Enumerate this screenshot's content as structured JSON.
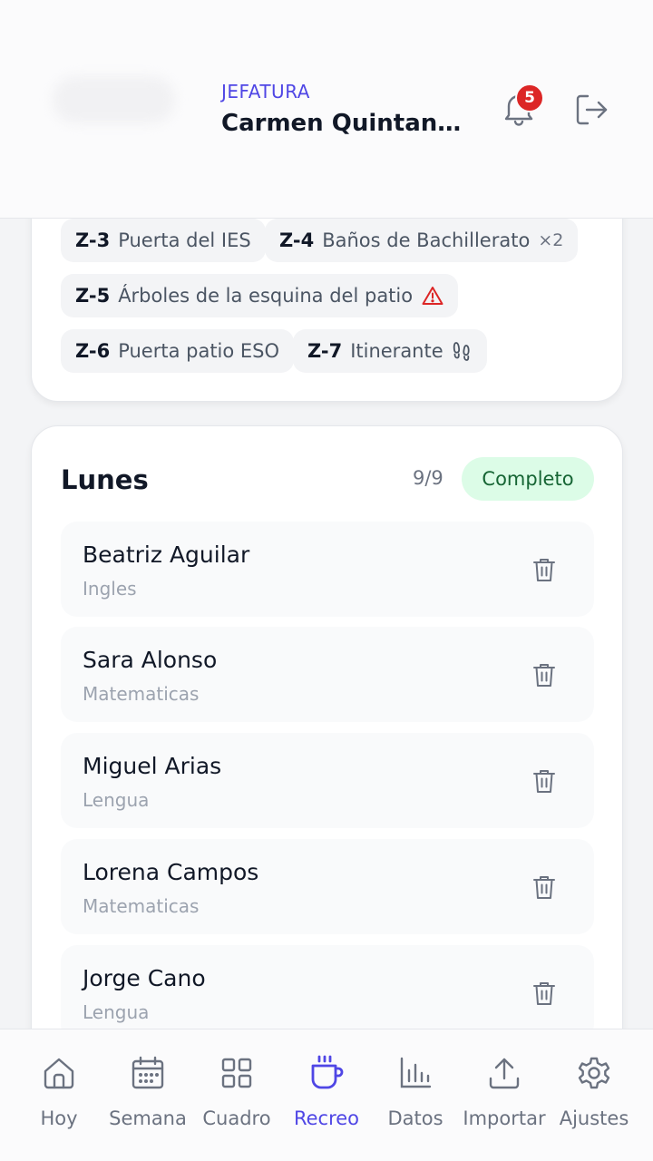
{
  "header": {
    "role": "JEFATURA",
    "user_name": "Carmen Quintana ...",
    "notifications_count": "5"
  },
  "zones": [
    {
      "code": "Z-3",
      "name": "Puerta del IES",
      "extra": "",
      "icon": ""
    },
    {
      "code": "Z-4",
      "name": "Baños de Bachillerato",
      "extra": "×2",
      "icon": ""
    },
    {
      "code": "Z-5",
      "name": "Árboles de la esquina del patio",
      "extra": "",
      "icon": "warning-icon"
    },
    {
      "code": "Z-6",
      "name": "Puerta patio ESO",
      "extra": "",
      "icon": ""
    },
    {
      "code": "Z-7",
      "name": "Itinerante",
      "extra": "",
      "icon": "footprints-icon"
    }
  ],
  "day": {
    "title": "Lunes",
    "count": "9/9",
    "status": "Completo",
    "teachers": [
      {
        "name": "Beatriz Aguilar",
        "subject": "Ingles"
      },
      {
        "name": "Sara Alonso",
        "subject": "Matematicas"
      },
      {
        "name": "Miguel Arias",
        "subject": "Lengua"
      },
      {
        "name": "Lorena Campos",
        "subject": "Matematicas"
      },
      {
        "name": "Jorge Cano",
        "subject": "Lengua"
      }
    ]
  },
  "nav": {
    "items": [
      {
        "label": "Hoy",
        "icon": "home-icon"
      },
      {
        "label": "Semana",
        "icon": "calendar-icon"
      },
      {
        "label": "Cuadro",
        "icon": "grid-icon"
      },
      {
        "label": "Recreo",
        "icon": "coffee-icon"
      },
      {
        "label": "Datos",
        "icon": "bar-chart-icon"
      },
      {
        "label": "Importar",
        "icon": "upload-icon"
      },
      {
        "label": "Ajustes",
        "icon": "gear-icon"
      }
    ],
    "active_index": 3
  },
  "colors": {
    "accent": "#4f46e5",
    "success_bg": "#dcfce7",
    "success_text": "#166534",
    "badge": "#dc2626",
    "warning": "#dc2626"
  }
}
